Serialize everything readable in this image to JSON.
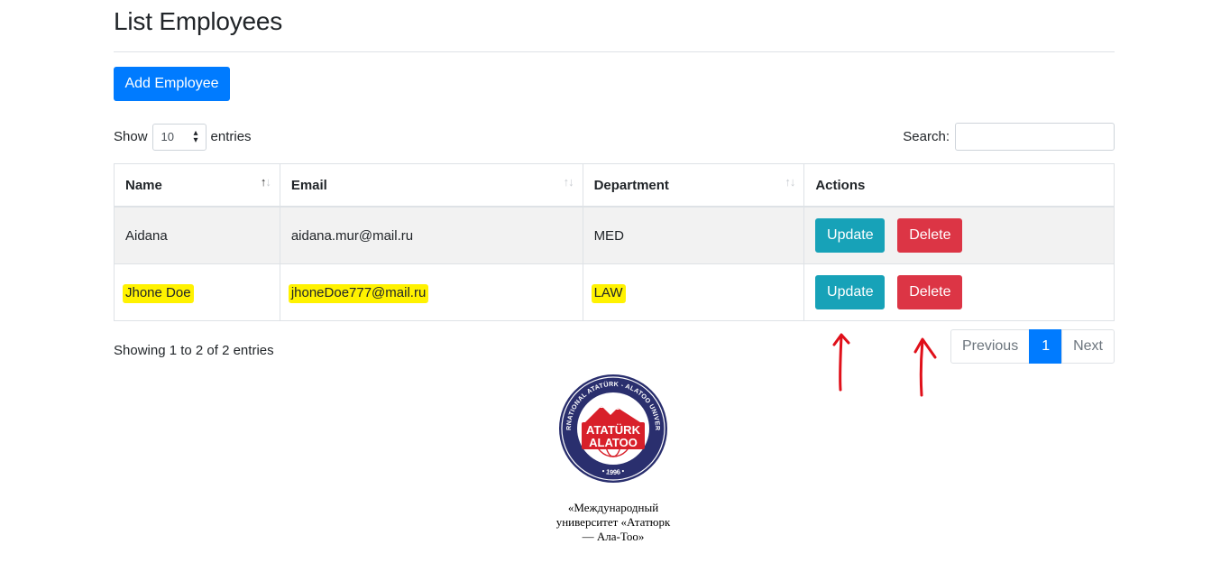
{
  "page": {
    "title": "List Employees"
  },
  "toolbar": {
    "add_label": "Add Employee"
  },
  "length": {
    "show": "Show",
    "value": "10",
    "entries": "entries"
  },
  "search": {
    "label": "Search:",
    "value": ""
  },
  "table": {
    "headers": {
      "name": "Name",
      "email": "Email",
      "department": "Department",
      "actions": "Actions"
    },
    "rows": [
      {
        "name": "Aidana",
        "email": "aidana.mur@mail.ru",
        "department": "MED",
        "highlighted": false
      },
      {
        "name": "Jhone Doe",
        "email": "jhoneDoe777@mail.ru",
        "department": "LAW",
        "highlighted": true
      }
    ],
    "update_label": "Update",
    "delete_label": "Delete"
  },
  "info": "Showing 1 to 2 of 2 entries",
  "pagination": {
    "previous": "Previous",
    "current": "1",
    "next": "Next"
  },
  "logo": {
    "ring_text": "INTERNATIONAL ATATÜRK - ALATOO UNIVERSITY",
    "line1": "ATATÜRK",
    "line2": "ALATOO",
    "year": "• 1996 •"
  },
  "caption": {
    "line1": "«Международный",
    "line2": "университет «Ататюрк",
    "line3": "— Ала-Тоо»"
  },
  "colors": {
    "primary": "#007bff",
    "info": "#17a2b8",
    "danger": "#dc3545",
    "highlight": "#fff200",
    "annotation_red": "#e0101a",
    "logo_navy": "#2a2f6e",
    "logo_red": "#d8202a"
  }
}
